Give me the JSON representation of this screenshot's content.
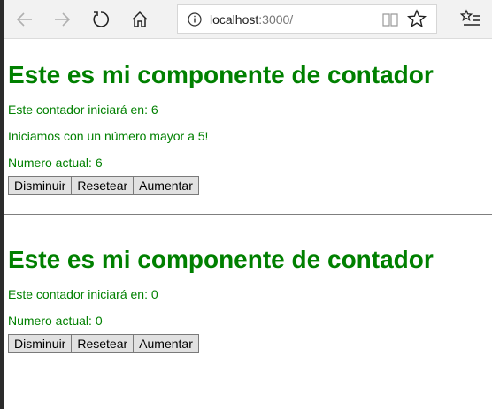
{
  "browser": {
    "address_host": "localhost",
    "address_path": ":3000/"
  },
  "counters": [
    {
      "title": "Este es mi componente de contador",
      "start_text": "Este contador iniciará en: 6",
      "message": "Iniciamos con un número mayor a 5!",
      "current_text": "Numero actual: 6",
      "buttons": {
        "decrease": "Disminuir",
        "reset": "Resetear",
        "increase": "Aumentar"
      }
    },
    {
      "title": "Este es mi componente de contador",
      "start_text": "Este contador iniciará en: 0",
      "current_text": "Numero actual: 0",
      "buttons": {
        "decrease": "Disminuir",
        "reset": "Resetear",
        "increase": "Aumentar"
      }
    }
  ],
  "colors": {
    "text_green": "#008000",
    "separator": "#7f7f7f"
  }
}
